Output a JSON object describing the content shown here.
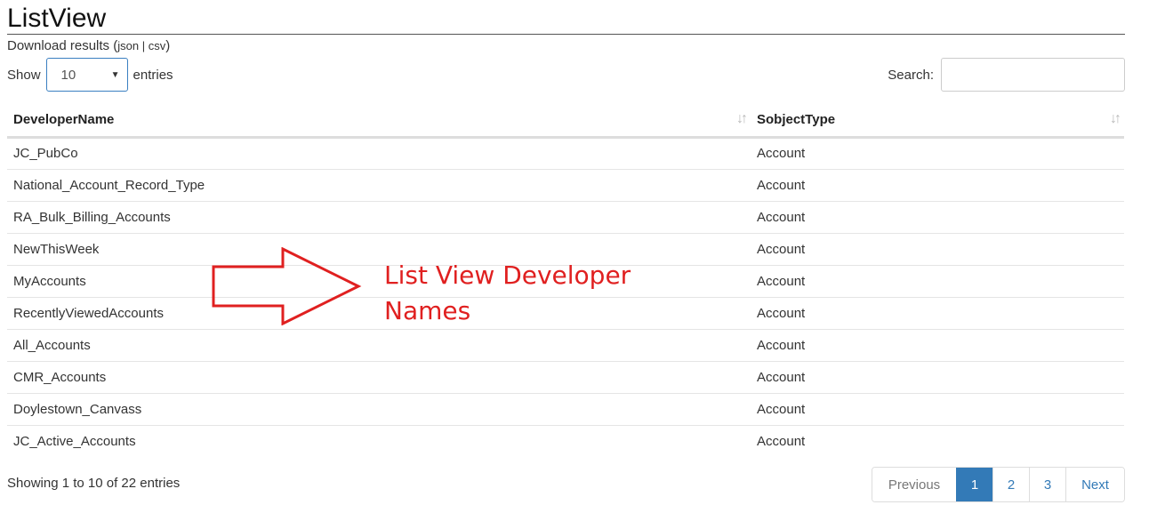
{
  "page": {
    "title": "ListView"
  },
  "download": {
    "prefix": "Download results (",
    "json": "json",
    "sep": " | ",
    "csv": "csv",
    "suffix": ")"
  },
  "length": {
    "show_label": "Show",
    "value": "10",
    "entries_label": "entries"
  },
  "search": {
    "label": "Search:",
    "value": "",
    "placeholder": ""
  },
  "table": {
    "headers": [
      "DeveloperName",
      "SobjectType"
    ],
    "rows": [
      [
        "JC_PubCo",
        "Account"
      ],
      [
        "National_Account_Record_Type",
        "Account"
      ],
      [
        "RA_Bulk_Billing_Accounts",
        "Account"
      ],
      [
        "NewThisWeek",
        "Account"
      ],
      [
        "MyAccounts",
        "Account"
      ],
      [
        "RecentlyViewedAccounts",
        "Account"
      ],
      [
        "All_Accounts",
        "Account"
      ],
      [
        "CMR_Accounts",
        "Account"
      ],
      [
        "Doylestown_Canvass",
        "Account"
      ],
      [
        "JC_Active_Accounts",
        "Account"
      ]
    ]
  },
  "info": {
    "text": "Showing 1 to 10 of 22 entries"
  },
  "pagination": {
    "previous": "Previous",
    "pages": [
      "1",
      "2",
      "3"
    ],
    "active": "1",
    "next": "Next"
  },
  "annotation": {
    "line1": "List View Developer",
    "line2": "Names",
    "color": "#e02020"
  },
  "colors": {
    "accent": "#337ab7",
    "select_border": "#3a7fc1"
  }
}
